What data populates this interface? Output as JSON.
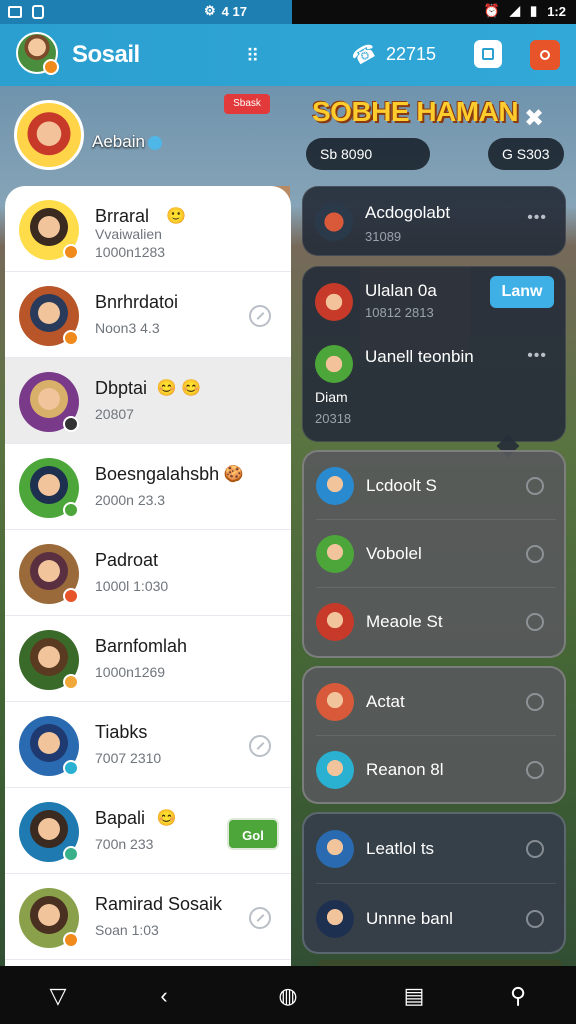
{
  "status_bar": {
    "time": "1:2",
    "left_text": "4 17"
  },
  "app_bar": {
    "title": "Sosail",
    "counter": "22715"
  },
  "hero": {
    "name": "Aebain",
    "tag": "Sbask"
  },
  "game_title": "SOBHE HAMAN",
  "stats": {
    "left": "Sb 8090",
    "right": "G S303"
  },
  "contacts": [
    {
      "name": "Brraral",
      "emoji": "🙂",
      "sub": "Vvaiwalien",
      "sub2": "1000n1283",
      "colors": [
        "#ffdd4a",
        "#3a2a20"
      ],
      "badge": "#f08a1a"
    },
    {
      "name": "Bnrhrdatoi",
      "emoji": "",
      "sub": "Noon3 4.3",
      "colors": [
        "#b8562a",
        "#2a3a5a"
      ],
      "badge": "#f08a1a"
    },
    {
      "name": "Dbptai",
      "emoji": "😊 😊",
      "sub": "20807",
      "colors": [
        "#7a3a8a",
        "#d8b06a"
      ],
      "badge": "#333333"
    },
    {
      "name": "Boesngalahsbh",
      "emoji": "🍪",
      "sub": "2000n 23.3",
      "colors": [
        "#4ca63a",
        "#1e3050"
      ],
      "badge": "#4ca63a"
    },
    {
      "name": "Padroat",
      "emoji": "",
      "sub": "1000l 1:030",
      "colors": [
        "#9a6a3a",
        "#5a3040"
      ],
      "badge": "#e8542a"
    },
    {
      "name": "Barnfomlah",
      "emoji": "",
      "sub": "1000n1269",
      "colors": [
        "#3a6a2a",
        "#5a3a20"
      ],
      "badge": "#f0a83a"
    },
    {
      "name": "Tiabks",
      "emoji": "",
      "sub": "7007 2310",
      "colors": [
        "#2a6ab0",
        "#1e3a70"
      ],
      "badge": "#2ab0d0"
    },
    {
      "name": "Bapali",
      "emoji": "😊",
      "sub": "700n 233",
      "colors": [
        "#1e7ab0",
        "#3a2a20"
      ],
      "badge": "#3ab08a"
    },
    {
      "name": "Ramirad Sosaik",
      "emoji": "",
      "sub": "Soan 1:03",
      "colors": [
        "#8aa04a",
        "#4a3020"
      ],
      "badge": "#f08a1a"
    }
  ],
  "go_button": "Gol",
  "right_feed": {
    "card1": {
      "name": "Acdogolabt",
      "sub": "31089"
    },
    "card2": [
      {
        "name": "Ulalan 0a",
        "sub": "10812 2813"
      },
      {
        "name": "Uanell teonbin"
      },
      {
        "name": "Diam",
        "sub": "20318"
      }
    ],
    "learn_label": "Lanw",
    "card3": [
      "Lcdoolt S",
      "Vobolel",
      "Meaole St"
    ],
    "card4": [
      "Actat",
      "Reanon 8l"
    ],
    "card5": [
      "Leatlol ts",
      "Unnne banl"
    ]
  }
}
